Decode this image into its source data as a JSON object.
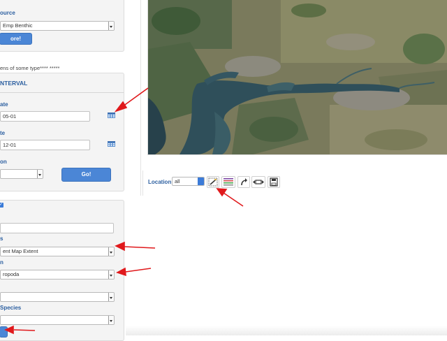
{
  "filters": {
    "source_label": "ource",
    "source_value": "Emp Benthic",
    "more_button": "ore!",
    "note": "ens of some type**** *****"
  },
  "interval": {
    "header": "NTERVAL",
    "start_label": "ate",
    "start_value": "05-01",
    "end_label": "te",
    "end_value": "12-01",
    "aggregation_label": "on",
    "go_button": "Go!"
  },
  "map_options": {
    "extent_label": "s",
    "extent_value": "ent Map Extent",
    "taxon_label": "n",
    "taxon_value": "ropoda",
    "species_label": "Species"
  },
  "map_toolbar": {
    "location_label": "Location",
    "location_value": "all",
    "tools": [
      "draw-select-tool",
      "legend-tool",
      "undo-tool",
      "pan-tool",
      "save-tool"
    ]
  },
  "colors": {
    "accent": "#4b86d6",
    "label_blue": "#2c5fa0",
    "annotation_red": "#e0191c"
  }
}
